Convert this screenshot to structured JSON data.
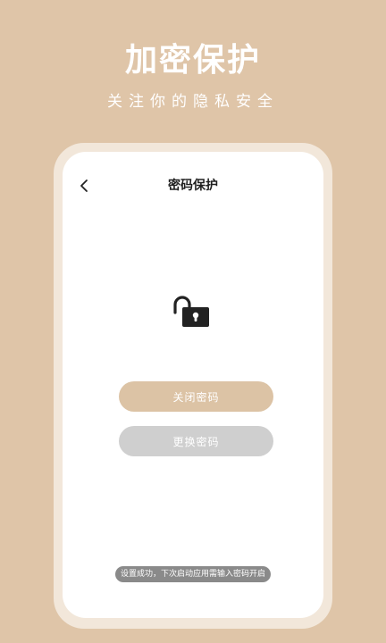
{
  "hero": {
    "title": "加密保护",
    "subtitle": "关注你的隐私安全"
  },
  "screen": {
    "nav_title": "密码保护",
    "back_icon": "chevron-left-icon",
    "lock_icon": "unlocked-padlock-icon",
    "buttons": {
      "close_password": "关闭密码",
      "change_password": "更换密码"
    },
    "toast": "设置成功，下次启动应用需输入密码开启"
  },
  "colors": {
    "background": "#dfc5a8",
    "primary_button": "#dcc3a5",
    "secondary_button": "#cfcfcf",
    "toast_bg": "#8a8a8a"
  }
}
